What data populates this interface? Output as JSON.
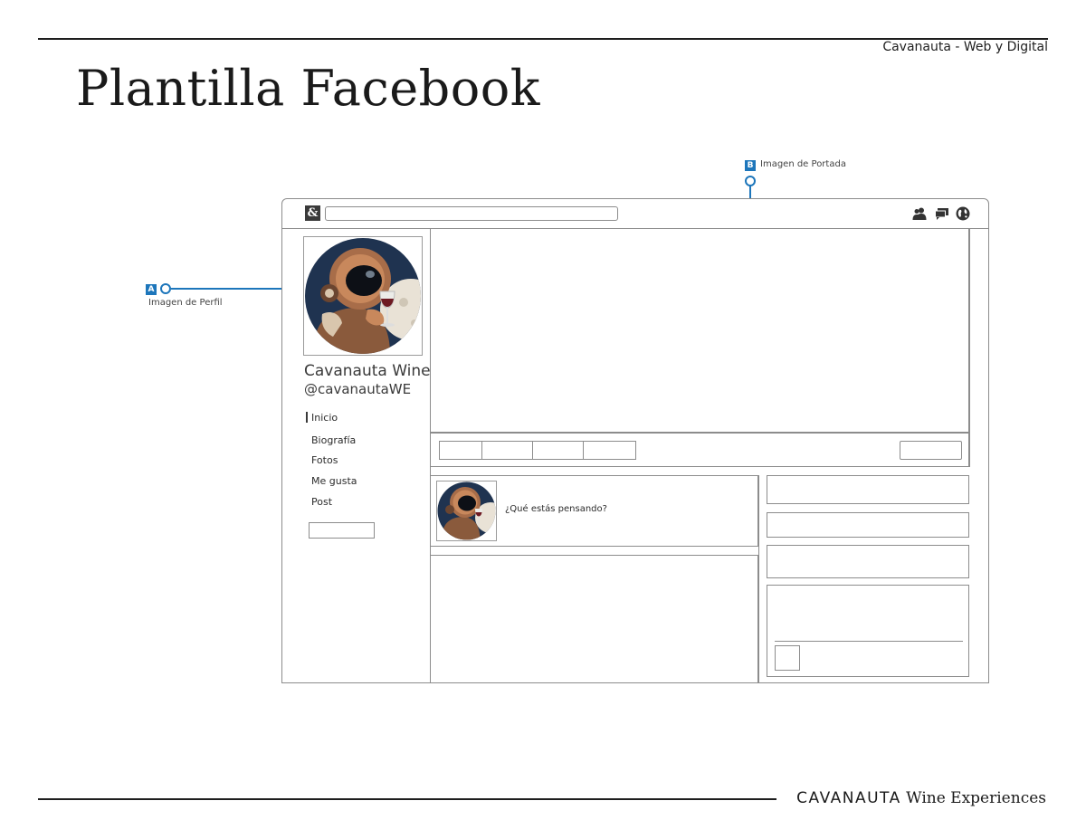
{
  "document": {
    "header_right": "Cavanauta - Web y Digital",
    "title": "Plantilla Facebook",
    "footer_brand": "CAVANAUTA",
    "footer_sub": "Wine Experiences"
  },
  "callouts": {
    "a": {
      "badge": "A",
      "label": "Imagen de Perfil"
    },
    "b": {
      "badge": "B",
      "label": "Imagen de Portada"
    }
  },
  "topbar": {
    "logo_glyph": "&",
    "icons": [
      "friends-icon",
      "messages-icon",
      "globe-icon"
    ]
  },
  "profile": {
    "name": "Cavanauta Wine",
    "handle": "@cavanautaWE"
  },
  "nav": {
    "items": [
      "Inicio",
      "Biografía",
      "Fotos",
      "Me gusta",
      "Post"
    ],
    "active": "Inicio"
  },
  "composer": {
    "prompt": "¿Qué estás pensando?"
  },
  "colors": {
    "accent": "#1d76bb",
    "frame": "#8c8c8c",
    "avatar_bg": "#1f3350",
    "suit": "#8a5a3c"
  }
}
